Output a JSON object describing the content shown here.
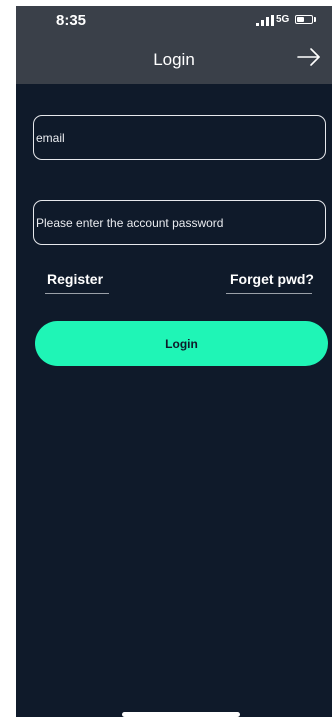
{
  "status_bar": {
    "time": "8:35",
    "network": "5G"
  },
  "header": {
    "title": "Login",
    "forward_icon": "arrow-right-icon"
  },
  "form": {
    "email_placeholder": "email",
    "email_value": "",
    "password_placeholder": "Please enter the account password",
    "password_value": ""
  },
  "links": {
    "register": "Register",
    "forgot": "Forget pwd?"
  },
  "login_button": "Login",
  "colors": {
    "background": "#0f1a2a",
    "header": "#3a4049",
    "accent": "#1ff5b6"
  }
}
